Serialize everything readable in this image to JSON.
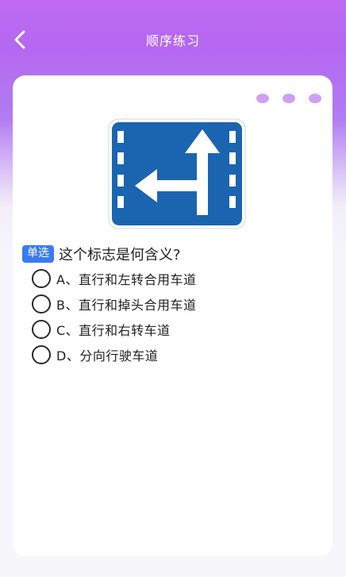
{
  "header": {
    "title": "顺序练习",
    "back_icon": "chevron-left-icon"
  },
  "card": {
    "more_icon": "more-dots-icon",
    "sign_icon": "straight-and-left-turn-lane-sign",
    "sign_color": "#1b64b0",
    "question": {
      "type_label": "单选",
      "text": "这个标志是何含义?",
      "options": [
        {
          "label": "A、直行和左转合用车道"
        },
        {
          "label": "B、直行和掉头合用车道"
        },
        {
          "label": "C、直行和右转车道"
        },
        {
          "label": "D、分向行驶车道"
        }
      ]
    }
  },
  "colors": {
    "header_gradient_top": "#c06af2",
    "badge": "#3a7af2",
    "dots": "#cf9ff3"
  }
}
